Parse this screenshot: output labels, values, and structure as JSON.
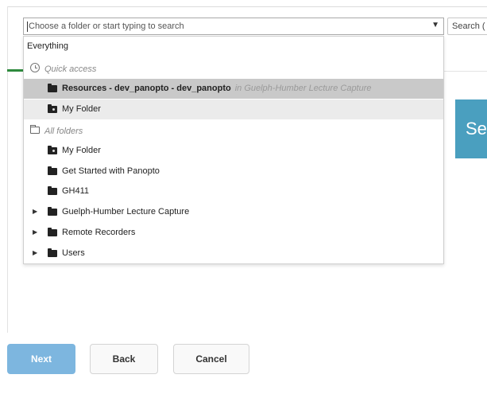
{
  "chooser": {
    "placeholder": "Choose a folder or start typing to search",
    "arrow": "▼"
  },
  "search": {
    "placeholder": "Search ("
  },
  "heading": {
    "visible_text": "Se"
  },
  "dropdown": {
    "everything_label": "Everything",
    "quick_access_header": "Quick access",
    "quick_access": [
      {
        "label": "Resources - dev_panopto - dev_panopto",
        "context": "in Guelph-Humber Lecture Capture",
        "state": "selected"
      },
      {
        "label": "My Folder",
        "state": "hover"
      }
    ],
    "all_folders_header": "All folders",
    "all_folders": [
      {
        "label": "My Folder",
        "expandable": false,
        "icon": "folder-camera-icon"
      },
      {
        "label": "Get Started with Panopto",
        "expandable": false,
        "icon": "folder-icon"
      },
      {
        "label": "GH411",
        "expandable": false,
        "icon": "folder-icon"
      },
      {
        "label": "Guelph-Humber Lecture Capture",
        "expandable": true,
        "icon": "folder-icon"
      },
      {
        "label": "Remote Recorders",
        "expandable": true,
        "icon": "folder-icon"
      },
      {
        "label": "Users",
        "expandable": true,
        "icon": "folder-icon"
      }
    ],
    "expand_glyph": "▶"
  },
  "buttons": {
    "next": "Next",
    "back": "Back",
    "cancel": "Cancel"
  },
  "colors": {
    "next_button": "#7db6df",
    "teal_heading": "#4a9fbf",
    "selected_row": "#c9c9c9",
    "green_accent": "#2e8a3d"
  }
}
